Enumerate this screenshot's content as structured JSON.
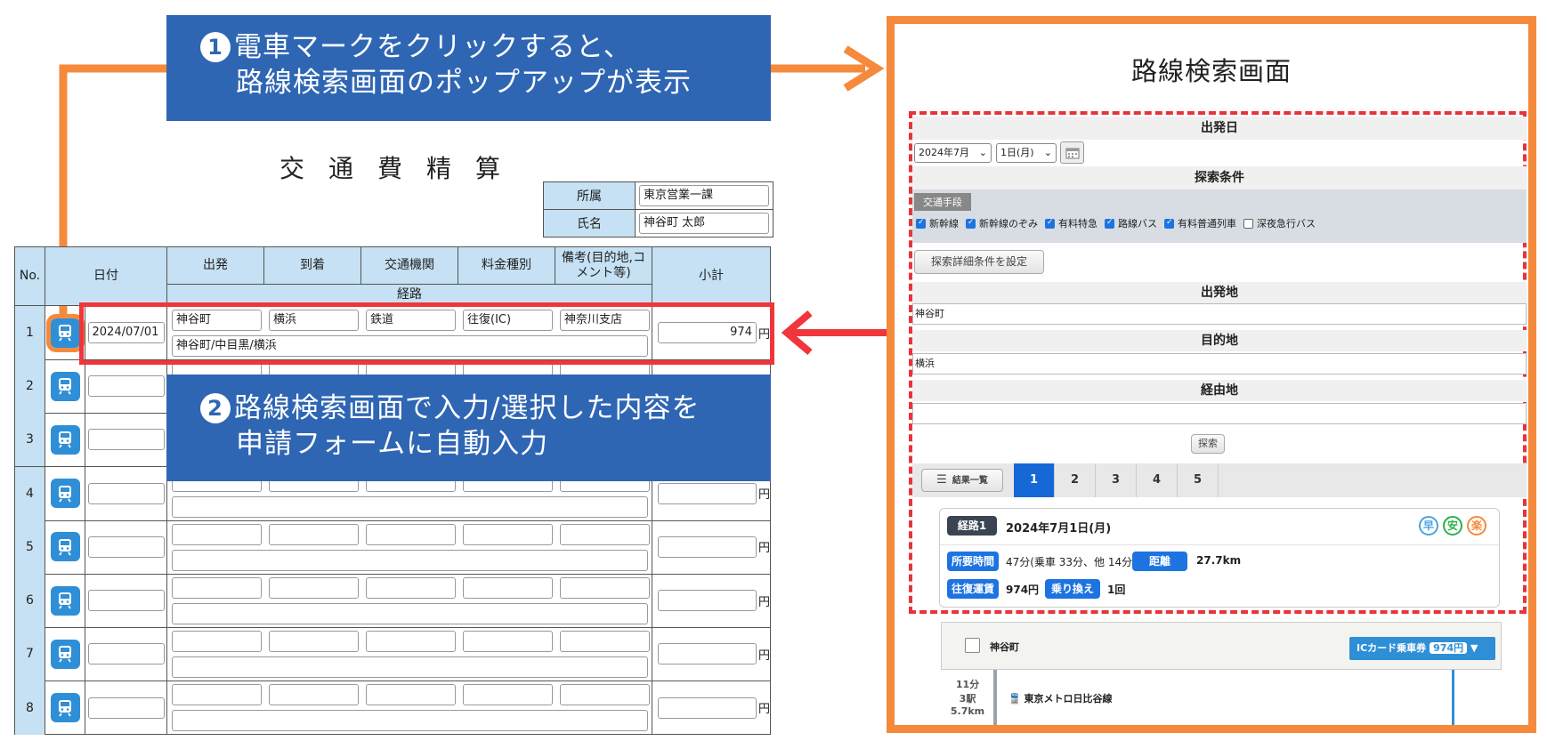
{
  "callouts": {
    "step1": {
      "num": "1",
      "line1": "電車マークをクリックすると、",
      "line2": "路線検索画面のポップアップが表示"
    },
    "step2": {
      "num": "2",
      "line1": "路線検索画面で入力/選択した内容を",
      "line2": "申請フォームに自動入力"
    }
  },
  "form": {
    "title": "交通費精算",
    "affiliation_label": "所属",
    "affiliation_value": "東京営業一課",
    "name_label": "氏名",
    "name_value": "神谷町 太郎",
    "headers": {
      "no": "No.",
      "date": "日付",
      "depart": "出発",
      "arrive": "到着",
      "transport": "交通機関",
      "fare_type": "料金種別",
      "note": "備考(目的地,コメント等)",
      "route": "経路",
      "subtotal": "小計"
    },
    "currency": "円",
    "rows": [
      {
        "no": "1",
        "date": "2024/07/01",
        "depart": "神谷町",
        "arrive": "横浜",
        "transport": "鉄道",
        "fare_type": "往復(IC)",
        "note": "神奈川支店",
        "route": "神谷町/中目黒/横浜",
        "subtotal": "974"
      },
      {
        "no": "2"
      },
      {
        "no": "3"
      },
      {
        "no": "4"
      },
      {
        "no": "5"
      },
      {
        "no": "6"
      },
      {
        "no": "7"
      },
      {
        "no": "8"
      }
    ]
  },
  "panel": {
    "title": "路線検索画面",
    "departure_date_label": "出発日",
    "month_select": "2024年7月",
    "day_select": "1日(月)",
    "search_cond_label": "探索条件",
    "transport_tag": "交通手段",
    "options": [
      {
        "label": "新幹線",
        "checked": true
      },
      {
        "label": "新幹線のぞみ",
        "checked": true
      },
      {
        "label": "有料特急",
        "checked": true
      },
      {
        "label": "路線バス",
        "checked": true
      },
      {
        "label": "有料普通列車",
        "checked": true
      },
      {
        "label": "深夜急行バス",
        "checked": false
      }
    ],
    "detail_button": "探索詳細条件を設定",
    "from_label": "出発地",
    "from_value": "神谷町",
    "to_label": "目的地",
    "to_value": "横浜",
    "via_label": "経由地",
    "via_value": "",
    "search_button": "探索",
    "result_list_button": "結果一覧",
    "tabs": [
      "1",
      "2",
      "3",
      "4",
      "5"
    ],
    "result": {
      "route_label": "経路1",
      "date": "2024年7月1日(月)",
      "badges": [
        "早",
        "安",
        "楽"
      ],
      "time_label": "所要時間",
      "time_value": "47分(乗車 33分、他 14分)",
      "distance_label": "距離",
      "distance_value": "27.7km",
      "fare_label": "往復運賃",
      "fare_value": "974円",
      "transfer_label": "乗り換え",
      "transfer_value": "1回"
    },
    "station": {
      "name": "神谷町",
      "ic_label": "ICカード乗車券",
      "ic_amount": "974円",
      "segment_time": "11分",
      "segment_stations": "3駅",
      "segment_distance": "5.7km",
      "line_name": "東京メトロ日比谷線"
    }
  },
  "colors": {
    "orange": "#f58a3c",
    "red": "#f0353b",
    "blue_callout": "#2f66b3",
    "header_blue": "#c5e1f3",
    "accent_blue": "#1d74e0"
  }
}
